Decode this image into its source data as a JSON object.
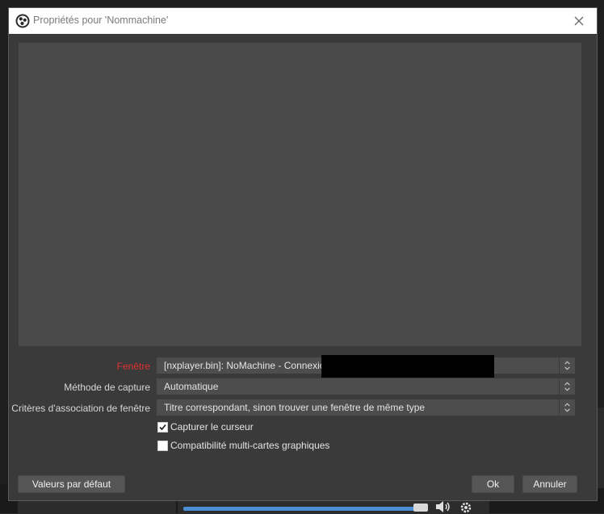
{
  "window": {
    "title": "Propriétés pour 'Nommachine'"
  },
  "properties": {
    "window_label": "Fenêtre",
    "window_value": "[nxplayer.bin]: NoMachine - Connexion à",
    "capture_method_label": "Méthode de capture",
    "capture_method_value": "Automatique",
    "match_priority_label": "Critères d'association de fenêtre",
    "match_priority_value": "Titre correspondant, sinon trouver une fenêtre de même type",
    "capture_cursor_label": "Capturer le curseur",
    "capture_cursor_checked": true,
    "multi_adapter_label": "Compatibilité multi-cartes graphiques",
    "multi_adapter_checked": false
  },
  "buttons": {
    "defaults": "Valeurs par défaut",
    "ok": "Ok",
    "cancel": "Annuler"
  },
  "colors": {
    "required_label": "#e03030",
    "dialog_bg": "#3a3a3a",
    "preview_bg": "#4a4a4a",
    "accent": "#4a8fd4"
  },
  "icons": {
    "app": "obs-logo-icon",
    "close": "close-icon",
    "combo_arrow": "updown-chevron-icon",
    "check": "checkmark-icon"
  }
}
